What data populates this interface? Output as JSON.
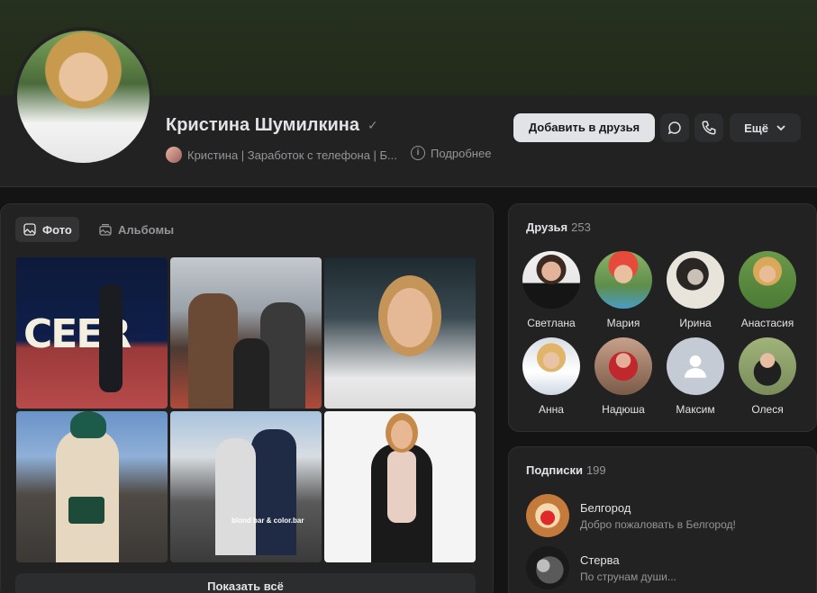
{
  "profile": {
    "name": "Кристина Шумилкина",
    "status": "Кристина | Заработок с телефона | Б...",
    "details_label": "Подробнее",
    "add_friend_label": "Добавить в друзья",
    "more_label": "Ещё"
  },
  "photos": {
    "tabs": [
      {
        "label": "Фото",
        "icon": "photo-icon",
        "active": true
      },
      {
        "label": "Альбомы",
        "icon": "album-icon",
        "active": false
      }
    ],
    "show_all_label": "Показать всё",
    "overlay_text": "blond bar & color.bar"
  },
  "friends": {
    "title": "Друзья",
    "count": "253",
    "items": [
      {
        "name": "Светлана"
      },
      {
        "name": "Мария"
      },
      {
        "name": "Ирина"
      },
      {
        "name": "Анастасия"
      },
      {
        "name": "Анна"
      },
      {
        "name": "Надюша"
      },
      {
        "name": "Максим"
      },
      {
        "name": "Олеся"
      }
    ]
  },
  "subscriptions": {
    "title": "Подписки",
    "count": "199",
    "items": [
      {
        "name": "Белгород",
        "desc": "Добро пожаловать в Белгород!"
      },
      {
        "name": "Стерва",
        "desc": "По струнам души..."
      }
    ]
  },
  "colors": {
    "background": "#141414",
    "panel": "#222222",
    "primary_button": "#e1e3e6",
    "secondary_button": "#2c2d2e",
    "text_secondary": "#939598"
  }
}
